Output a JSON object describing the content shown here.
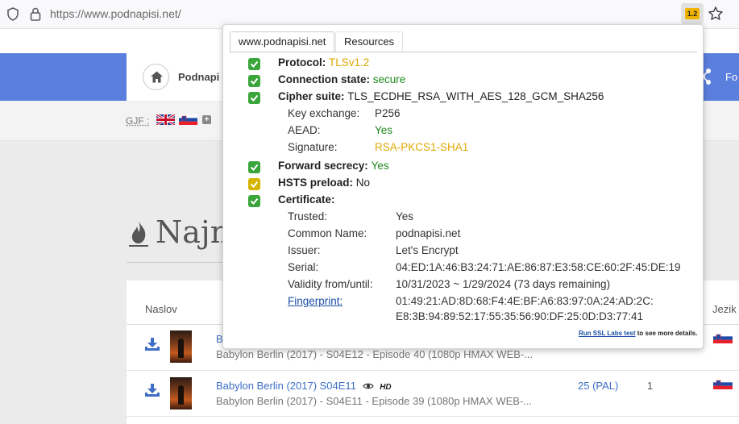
{
  "browser": {
    "url": "https://www.podnapisi.net/",
    "tls_badge": "1.2"
  },
  "site": {
    "name": "Podnapi",
    "nav_right": "Fo",
    "gjf_label": "GJF :",
    "heading": "Najn",
    "table": {
      "col_title": "Naslov",
      "col_lang": "Jezik",
      "rows": [
        {
          "title": "B",
          "subtitle": "Babylon Berlin (2017) - S04E12 - Episode 40 (1080p HMAX WEB-...",
          "fps": "",
          "count": ""
        },
        {
          "title": "Babylon Berlin (2017) S04E11",
          "hd": "HD",
          "subtitle": "Babylon Berlin (2017) - S04E11 - Episode 39 (1080p HMAX WEB-...",
          "fps": "25 (PAL)",
          "count": "1"
        }
      ]
    }
  },
  "popup": {
    "tabs": [
      "www.podnapisi.net",
      "Resources"
    ],
    "protocol": {
      "label": "Protocol:",
      "value": "TLSv1.2"
    },
    "connection_state": {
      "label": "Connection state:",
      "value": "secure"
    },
    "cipher_suite": {
      "label": "Cipher suite:",
      "value": "TLS_ECDHE_RSA_WITH_AES_128_GCM_SHA256"
    },
    "cipher_details": [
      {
        "key": "Key exchange:",
        "value": "P256"
      },
      {
        "key": "AEAD:",
        "value": "Yes"
      },
      {
        "key": "Signature:",
        "value": "RSA-PKCS1-SHA1"
      }
    ],
    "forward_secrecy": {
      "label": "Forward secrecy:",
      "value": "Yes"
    },
    "hsts_preload": {
      "label": "HSTS preload:",
      "value": "No"
    },
    "certificate_label": "Certificate:",
    "certificate": [
      {
        "key": "Trusted:",
        "value": "Yes"
      },
      {
        "key": "Common Name:",
        "value": "podnapisi.net"
      },
      {
        "key": "Issuer:",
        "value": "Let's Encrypt"
      },
      {
        "key": "Serial:",
        "value": "04:ED:1A:46:B3:24:71:AE:86:87:E3:58:CE:60:2F:45:DE:19"
      },
      {
        "key": "Validity from/until:",
        "value": "10/31/2023 ~ 1/29/2024 (73 days remaining)"
      }
    ],
    "fingerprint": {
      "label": "Fingerprint:",
      "line1": "01:49:21:AD:8D:68:F4:4E:BF:A6:83:97:0A:24:AD:2C:",
      "line2": "E8:3B:94:89:52:17:55:35:56:90:DF:25:0D:D3:77:41"
    },
    "footer": {
      "link": "Run SSL Labs test",
      "rest": "to see more details."
    }
  },
  "colors": {
    "good": "#1e8a1e",
    "warn": "#e0a800",
    "check_green": "#3aa53a",
    "check_yellow": "#d4b400",
    "nav_blue": "#5b7fdd"
  }
}
